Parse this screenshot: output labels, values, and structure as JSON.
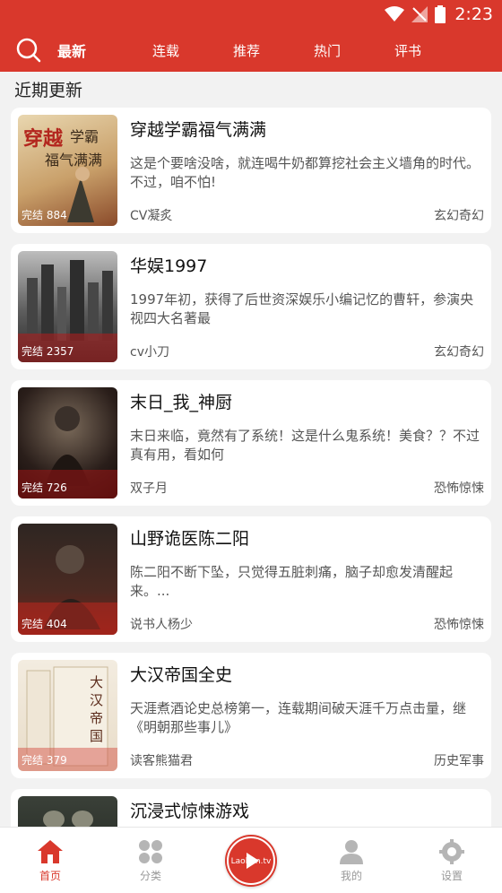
{
  "status": {
    "time": "2:23"
  },
  "nav": {
    "tabs": [
      "最新",
      "连载",
      "推荐",
      "热门",
      "评书"
    ],
    "active_index": 0
  },
  "section_title": "近期更新",
  "books": [
    {
      "title": "穿越学霸福气满满",
      "desc": "这是个要啥没啥，就连喝牛奶都算挖社会主义墙角的时代。不过，咱不怕!",
      "author": "CV凝炙",
      "genre": "玄幻奇幻",
      "cover_label": "完结 884"
    },
    {
      "title": "华娱1997",
      "desc": "1997年初，获得了后世资深娱乐小编记忆的曹轩，参演央视四大名著最",
      "author": "cv小刀",
      "genre": "玄幻奇幻",
      "cover_label": "完结 2357"
    },
    {
      "title": "末日_我_神厨",
      "desc": "末日来临，竟然有了系统！这是什么鬼系统！美食？？不过真有用，看如何",
      "author": "双子月",
      "genre": "恐怖惊悚",
      "cover_label": "完结 726"
    },
    {
      "title": "山野诡医陈二阳",
      "desc": " 陈二阳不断下坠，只觉得五脏刺痛，脑子却愈发清醒起来。...",
      "author": "说书人杨少",
      "genre": "恐怖惊悚",
      "cover_label": "完结 404"
    },
    {
      "title": "大汉帝国全史",
      "desc": "天涯煮酒论史总榜第一，连载期间破天涯千万点击量，继《明朝那些事儿》",
      "author": "读客熊猫君",
      "genre": "历史军事",
      "cover_label": "完结 379"
    },
    {
      "title": "沉浸式惊悚游戏",
      "desc": "",
      "author": "",
      "genre": "",
      "cover_label": ""
    }
  ],
  "bottom_nav": {
    "home": "首页",
    "category": "分类",
    "player_logo": "Laoban.tv",
    "mine": "我的",
    "settings": "设置"
  },
  "colors": {
    "brand": "#d9382c",
    "inactive": "#999999"
  }
}
